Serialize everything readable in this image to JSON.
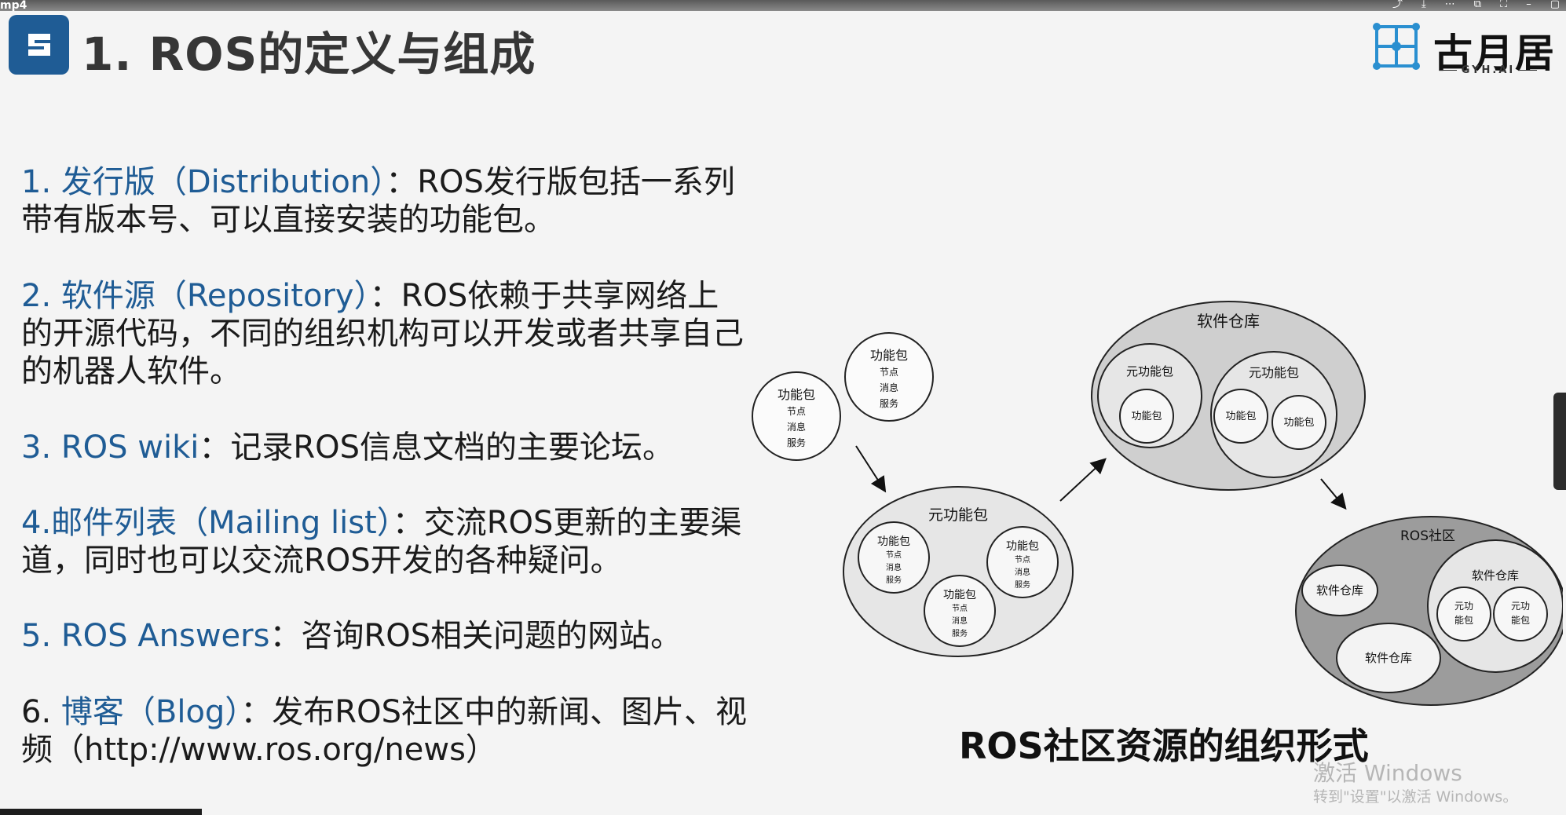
{
  "player": {
    "file_label": "mp4",
    "icons": [
      "share-icon",
      "download-icon",
      "more-icon",
      "picture-in-picture-icon",
      "fullscreen-icon",
      "minimize-icon",
      "maximize-icon"
    ]
  },
  "slide": {
    "title": "1. ROS的定义与组成",
    "brand": {
      "name": "古月居",
      "sub": "GYH.AI"
    },
    "items": [
      {
        "label": "1. 发行版（Distribution）",
        "text_line1": "：ROS发行版包括一系列",
        "text_rest": [
          "带有版本号、可以直接安装的功能包。"
        ]
      },
      {
        "label": "2. 软件源（Repository）",
        "text_line1": "：ROS依赖于共享网络上",
        "text_rest": [
          "的开源代码，不同的组织机构可以开发或者共享自己",
          "的机器人软件。"
        ]
      },
      {
        "label": "3. ROS wiki",
        "text_line1": "：记录ROS信息文档的主要论坛。",
        "text_rest": []
      },
      {
        "label": "4.邮件列表（Mailing list）",
        "text_line1": "：交流ROS更新的主要渠",
        "text_rest": [
          "道，同时也可以交流ROS开发的各种疑问。"
        ]
      },
      {
        "label": "5. ROS Answers",
        "text_line1": "：咨询ROS相关问题的网站。",
        "text_rest": []
      },
      {
        "num": "6. ",
        "label": "博客（Blog）",
        "text_line1": "：发布ROS社区中的新闻、图片、视",
        "text_rest": [
          "频（http://www.ros.org/news）"
        ]
      }
    ],
    "diagram": {
      "pkg": "功能包",
      "meta_pkg": "元功能包",
      "repo": "软件仓库",
      "community": "ROS社区",
      "node": "节点",
      "msg": "消息",
      "srv": "服务",
      "meta_pkg_split_1": "元功",
      "meta_pkg_split_2": "能包"
    },
    "caption": "ROS社区资源的组织形式"
  },
  "watermark": {
    "title": "激活 Windows",
    "sub": "转到\"设置\"以激活 Windows。"
  },
  "colors": {
    "accent": "#1f5c95",
    "text": "#1b1b1b",
    "circle_fill": "#e6e6e6",
    "circle_dark": "#cfcfcf"
  }
}
